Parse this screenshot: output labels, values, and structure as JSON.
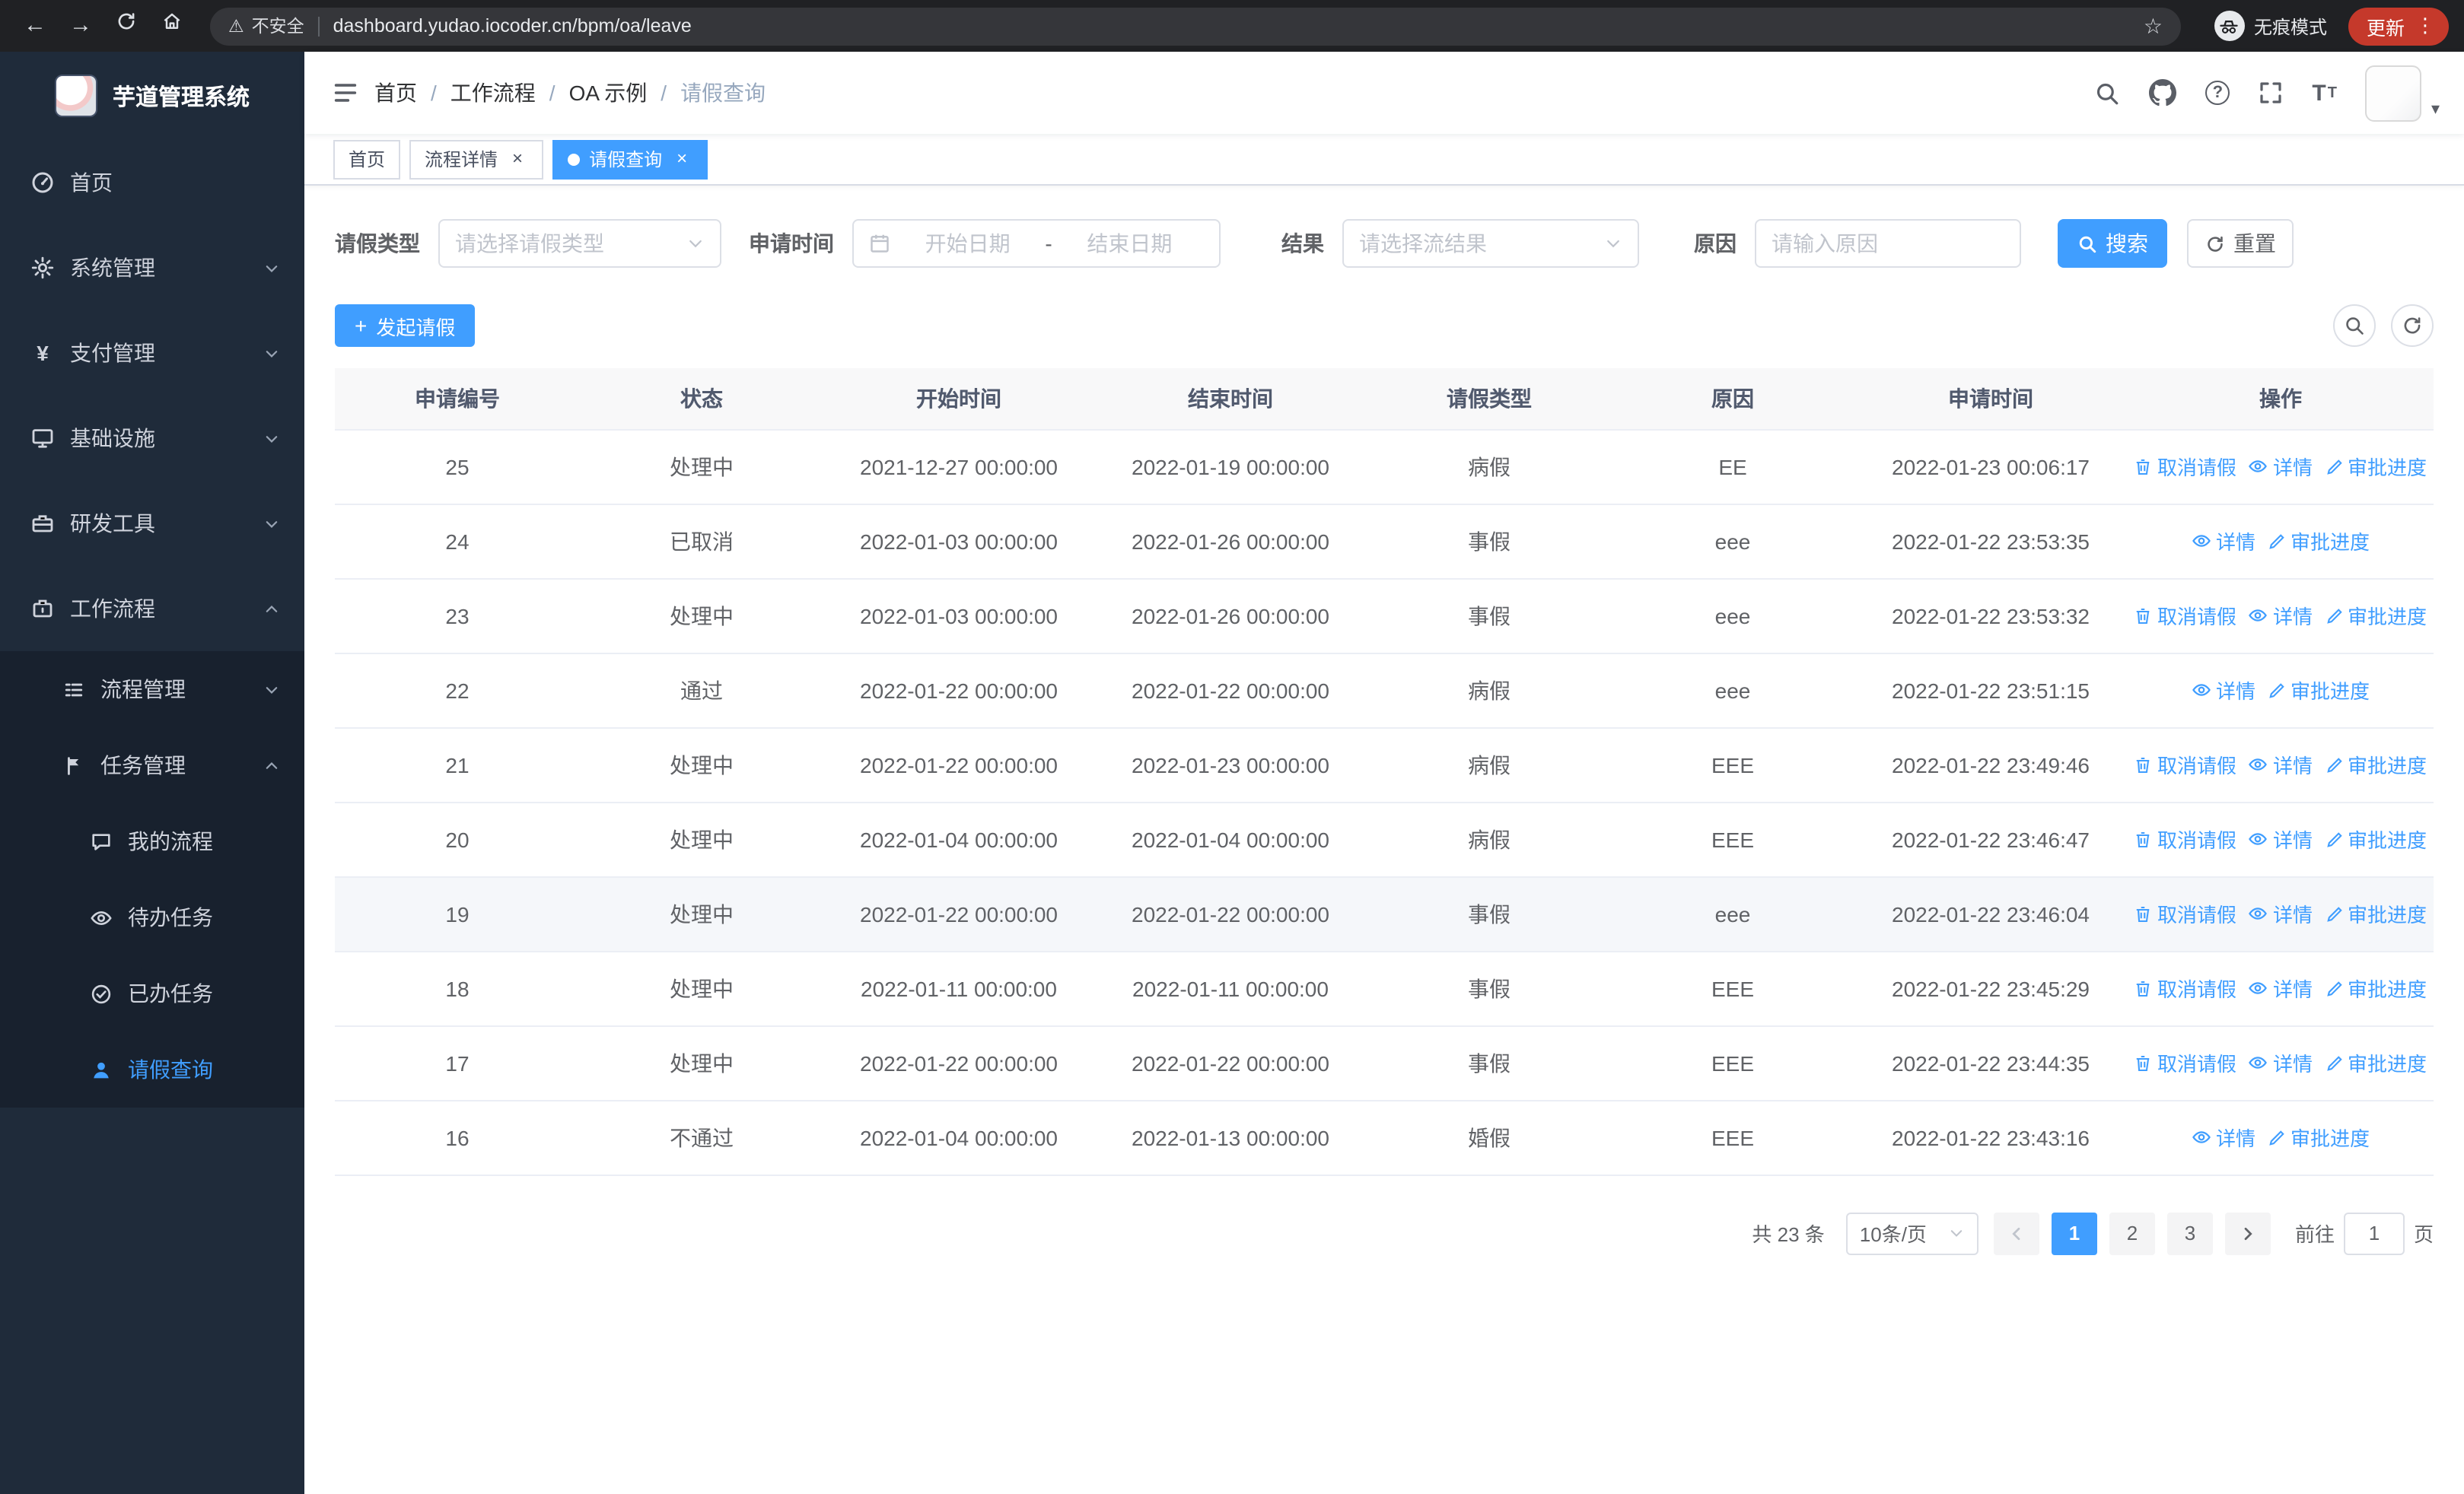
{
  "browser": {
    "security_label": "不安全",
    "url": "dashboard.yudao.iocoder.cn/bpm/oa/leave",
    "incognito_label": "无痕模式",
    "update_label": "更新"
  },
  "glyphs": {
    "back": "←",
    "forward": "→",
    "warning": "⚠",
    "star": "☆",
    "menu_dots": "⋮",
    "close": "×",
    "plus": "+",
    "yen": "¥",
    "question": "?",
    "font_large": "T",
    "font_small": "T",
    "caret_down": "▾"
  },
  "sidebar": {
    "title": "芋道管理系统",
    "items": [
      {
        "label": "首页"
      },
      {
        "label": "系统管理"
      },
      {
        "label": "支付管理"
      },
      {
        "label": "基础设施"
      },
      {
        "label": "研发工具"
      },
      {
        "label": "工作流程"
      }
    ],
    "sub_items": [
      {
        "label": "流程管理"
      },
      {
        "label": "任务管理"
      }
    ],
    "task_items": [
      {
        "label": "我的流程"
      },
      {
        "label": "待办任务"
      },
      {
        "label": "已办任务"
      },
      {
        "label": "请假查询"
      }
    ]
  },
  "navbar": {
    "breadcrumb": [
      "首页",
      "工作流程",
      "OA 示例",
      "请假查询"
    ],
    "separator": "/"
  },
  "tabs": [
    {
      "label": "首页"
    },
    {
      "label": "流程详情"
    },
    {
      "label": "请假查询"
    }
  ],
  "filters": {
    "leave_type_label": "请假类型",
    "leave_type_placeholder": "请选择请假类型",
    "apply_time_label": "申请时间",
    "date_start_placeholder": "开始日期",
    "date_separator": "-",
    "date_end_placeholder": "结束日期",
    "result_label": "结果",
    "result_placeholder": "请选择流结果",
    "reason_label": "原因",
    "reason_placeholder": "请输入原因",
    "search_button": "搜索",
    "reset_button": "重置"
  },
  "toolbar": {
    "create_button": "发起请假"
  },
  "table": {
    "headers": [
      "申请编号",
      "状态",
      "开始时间",
      "结束时间",
      "请假类型",
      "原因",
      "申请时间",
      "操作"
    ],
    "action_labels": {
      "cancel": "取消请假",
      "detail": "详情",
      "progress": "审批进度"
    },
    "rows": [
      {
        "id": "25",
        "status": "处理中",
        "start": "2021-12-27 00:00:00",
        "end": "2022-01-19 00:00:00",
        "type": "病假",
        "reason": "EE",
        "applied": "2022-01-23 00:06:17",
        "actions": [
          "cancel",
          "detail",
          "progress"
        ]
      },
      {
        "id": "24",
        "status": "已取消",
        "start": "2022-01-03 00:00:00",
        "end": "2022-01-26 00:00:00",
        "type": "事假",
        "reason": "eee",
        "applied": "2022-01-22 23:53:35",
        "actions": [
          "detail",
          "progress"
        ]
      },
      {
        "id": "23",
        "status": "处理中",
        "start": "2022-01-03 00:00:00",
        "end": "2022-01-26 00:00:00",
        "type": "事假",
        "reason": "eee",
        "applied": "2022-01-22 23:53:32",
        "actions": [
          "cancel",
          "detail",
          "progress"
        ]
      },
      {
        "id": "22",
        "status": "通过",
        "start": "2022-01-22 00:00:00",
        "end": "2022-01-22 00:00:00",
        "type": "病假",
        "reason": "eee",
        "applied": "2022-01-22 23:51:15",
        "actions": [
          "detail",
          "progress"
        ]
      },
      {
        "id": "21",
        "status": "处理中",
        "start": "2022-01-22 00:00:00",
        "end": "2022-01-23 00:00:00",
        "type": "病假",
        "reason": "EEE",
        "applied": "2022-01-22 23:49:46",
        "actions": [
          "cancel",
          "detail",
          "progress"
        ]
      },
      {
        "id": "20",
        "status": "处理中",
        "start": "2022-01-04 00:00:00",
        "end": "2022-01-04 00:00:00",
        "type": "病假",
        "reason": "EEE",
        "applied": "2022-01-22 23:46:47",
        "actions": [
          "cancel",
          "detail",
          "progress"
        ]
      },
      {
        "id": "19",
        "status": "处理中",
        "start": "2022-01-22 00:00:00",
        "end": "2022-01-22 00:00:00",
        "type": "事假",
        "reason": "eee",
        "applied": "2022-01-22 23:46:04",
        "actions": [
          "cancel",
          "detail",
          "progress"
        ],
        "highlighted": true
      },
      {
        "id": "18",
        "status": "处理中",
        "start": "2022-01-11 00:00:00",
        "end": "2022-01-11 00:00:00",
        "type": "事假",
        "reason": "EEE",
        "applied": "2022-01-22 23:45:29",
        "actions": [
          "cancel",
          "detail",
          "progress"
        ]
      },
      {
        "id": "17",
        "status": "处理中",
        "start": "2022-01-22 00:00:00",
        "end": "2022-01-22 00:00:00",
        "type": "事假",
        "reason": "EEE",
        "applied": "2022-01-22 23:44:35",
        "actions": [
          "cancel",
          "detail",
          "progress"
        ]
      },
      {
        "id": "16",
        "status": "不通过",
        "start": "2022-01-04 00:00:00",
        "end": "2022-01-13 00:00:00",
        "type": "婚假",
        "reason": "EEE",
        "applied": "2022-01-22 23:43:16",
        "actions": [
          "detail",
          "progress"
        ]
      }
    ]
  },
  "pagination": {
    "total_text": "共 23 条",
    "page_size_text": "10条/页",
    "pages": [
      "1",
      "2",
      "3"
    ],
    "active_page": "1",
    "goto_prefix": "前往",
    "goto_value": "1",
    "goto_suffix": "页"
  }
}
